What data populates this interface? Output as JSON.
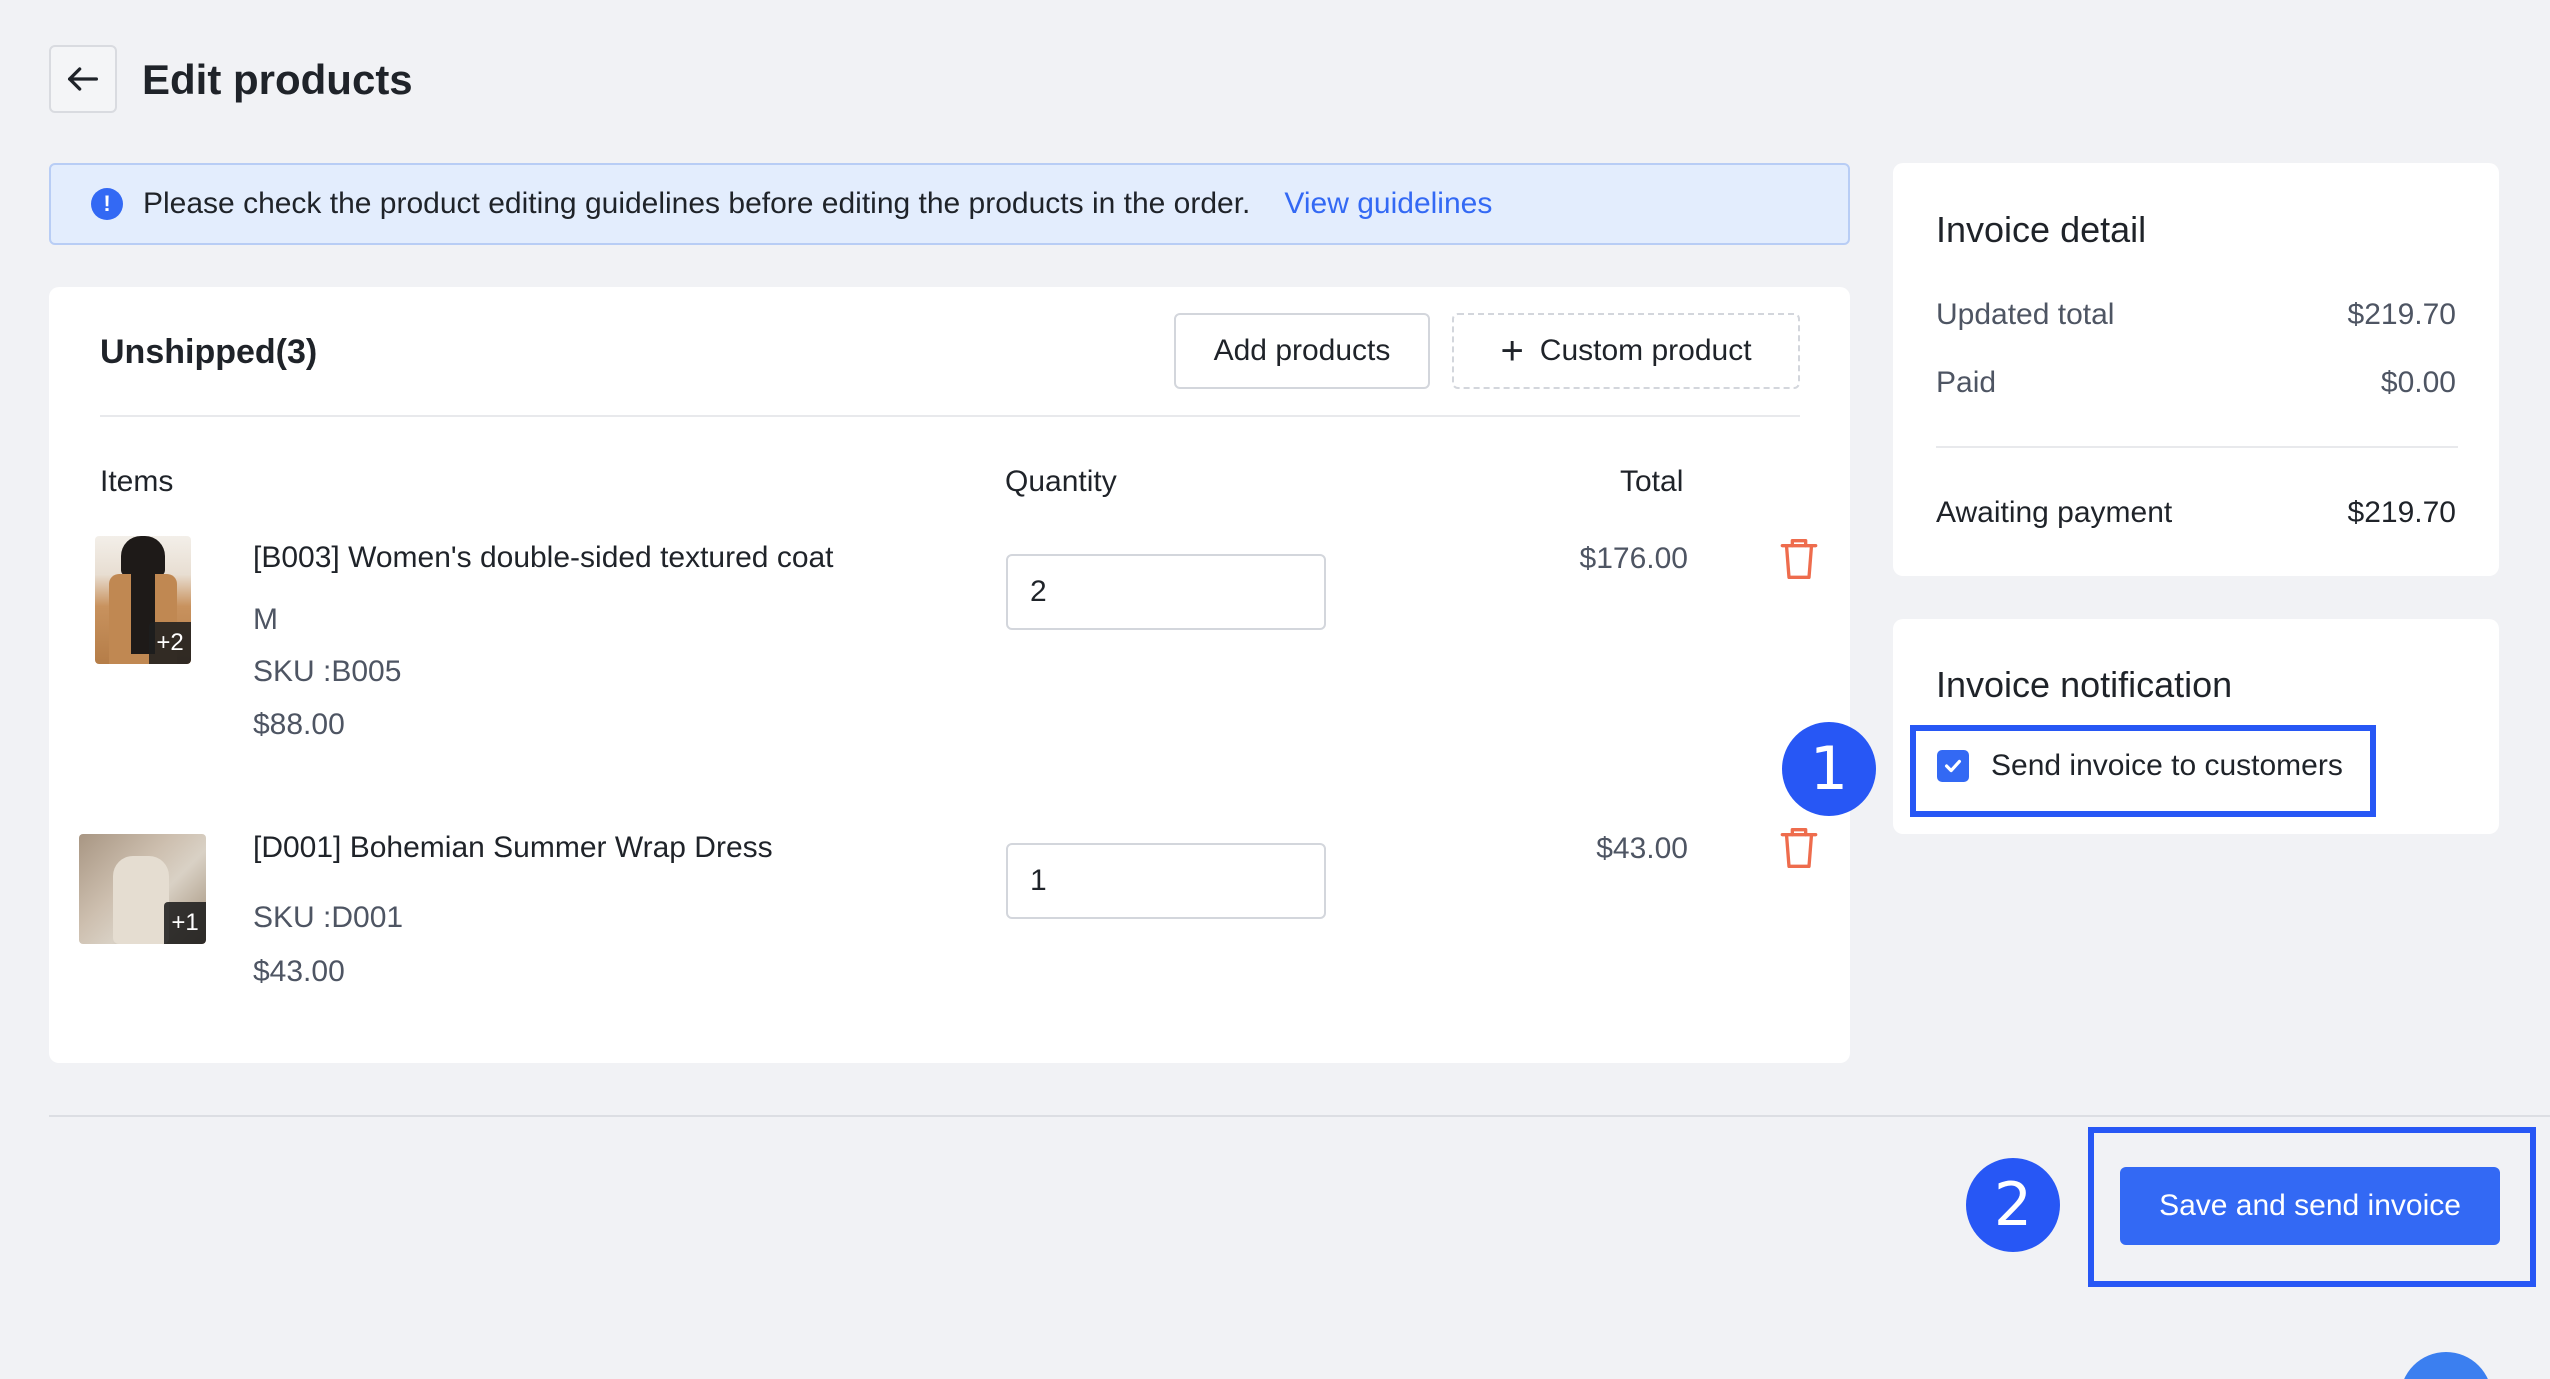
{
  "header": {
    "title": "Edit products",
    "back_icon": "arrow-left-icon"
  },
  "notice": {
    "text": "Please check the product editing guidelines before editing the products in the order.",
    "link": "View guidelines",
    "icon_glyph": "!"
  },
  "unshipped": {
    "title": "Unshipped(3)",
    "add_products_label": "Add products",
    "custom_product_label": "Custom product",
    "columns": {
      "items": "Items",
      "quantity": "Quantity",
      "total": "Total"
    },
    "products": [
      {
        "name": "[B003] Women's double-sided textured coat",
        "variant": "M",
        "sku": "SKU :B005",
        "price": "$88.00",
        "quantity": "2",
        "total": "$176.00",
        "image_badge": "+2"
      },
      {
        "name": "[D001] Bohemian Summer Wrap Dress",
        "sku": "SKU :D001",
        "price": "$43.00",
        "quantity": "1",
        "total": "$43.00",
        "image_badge": "+1"
      }
    ]
  },
  "invoice_detail": {
    "title": "Invoice detail",
    "rows": [
      {
        "label": "Updated total",
        "value": "$219.70"
      },
      {
        "label": "Paid",
        "value": "$0.00"
      }
    ],
    "awaiting": {
      "label": "Awaiting payment",
      "value": "$219.70"
    }
  },
  "invoice_notification": {
    "title": "Invoice notification",
    "send_invoice_label": "Send invoice to customers",
    "checked": true
  },
  "steps": {
    "step1": "1",
    "step2": "2"
  },
  "footer": {
    "save_label": "Save and send invoice"
  },
  "colors": {
    "accent": "#3369f4",
    "highlight": "#2757f5",
    "danger": "#ee6c4d"
  }
}
